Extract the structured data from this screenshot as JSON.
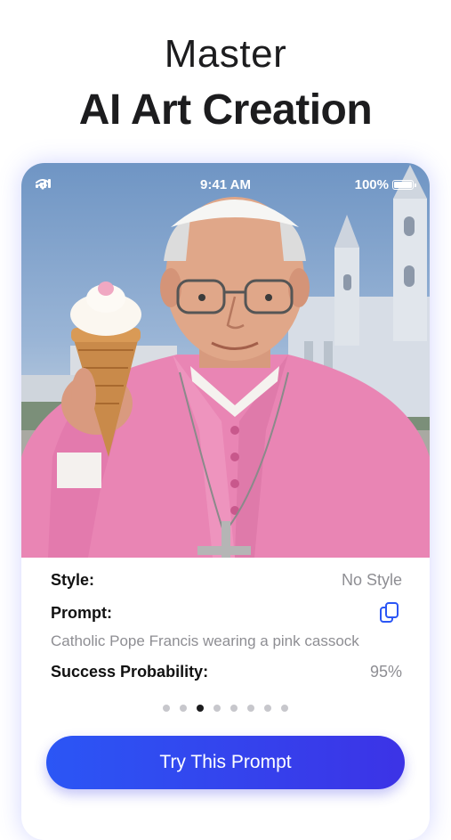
{
  "headline": {
    "line1": "Master",
    "line2": "AI Art Creation"
  },
  "statusbar": {
    "time": "9:41 AM",
    "battery": "100%"
  },
  "details": {
    "style_label": "Style:",
    "style_value": "No Style",
    "prompt_label": "Prompt:",
    "prompt_text": "Catholic Pope Francis wearing a pink cassock",
    "probability_label": "Success Probability:",
    "probability_value": "95%"
  },
  "pagination": {
    "total": 8,
    "active_index": 2
  },
  "cta": {
    "label": "Try This Prompt"
  },
  "colors": {
    "accent": "#2b56f5",
    "accent_end": "#3c33e6",
    "muted_text": "#8e8e93"
  }
}
